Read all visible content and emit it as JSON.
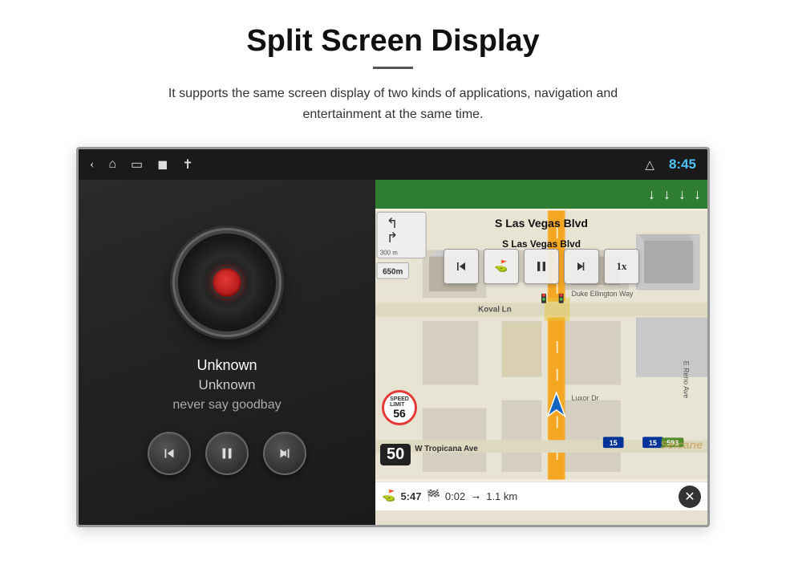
{
  "page": {
    "title": "Split Screen Display",
    "description": "It supports the same screen display of two kinds of applications, navigation and entertainment at the same time."
  },
  "status_bar": {
    "time": "8:45",
    "icons": [
      "back",
      "home",
      "recent",
      "image",
      "usb",
      "eject"
    ]
  },
  "music": {
    "track_1": "Unknown",
    "track_2": "Unknown",
    "album": "never say goodbay",
    "prev_label": "previous",
    "play_label": "play/pause",
    "next_label": "next"
  },
  "navigation": {
    "road_name": "S Las Vegas Blvd",
    "speed_label": "SPEED\nLIMIT",
    "speed_num": "56",
    "road_num": "50",
    "dist_1": "300 m",
    "dist_2": "650 m",
    "bottom_time": "5:47",
    "bottom_duration": "0:02",
    "bottom_dist": "1.1 km",
    "playback_btns": [
      "prev",
      "checkerboard",
      "pause",
      "next",
      "1x"
    ],
    "watermark": "Seicane"
  },
  "colors": {
    "nav_green": "#2e7d32",
    "status_bg": "#1a1a1a",
    "music_bg": "#1e1e1e",
    "time_blue": "#4fc3f7"
  }
}
